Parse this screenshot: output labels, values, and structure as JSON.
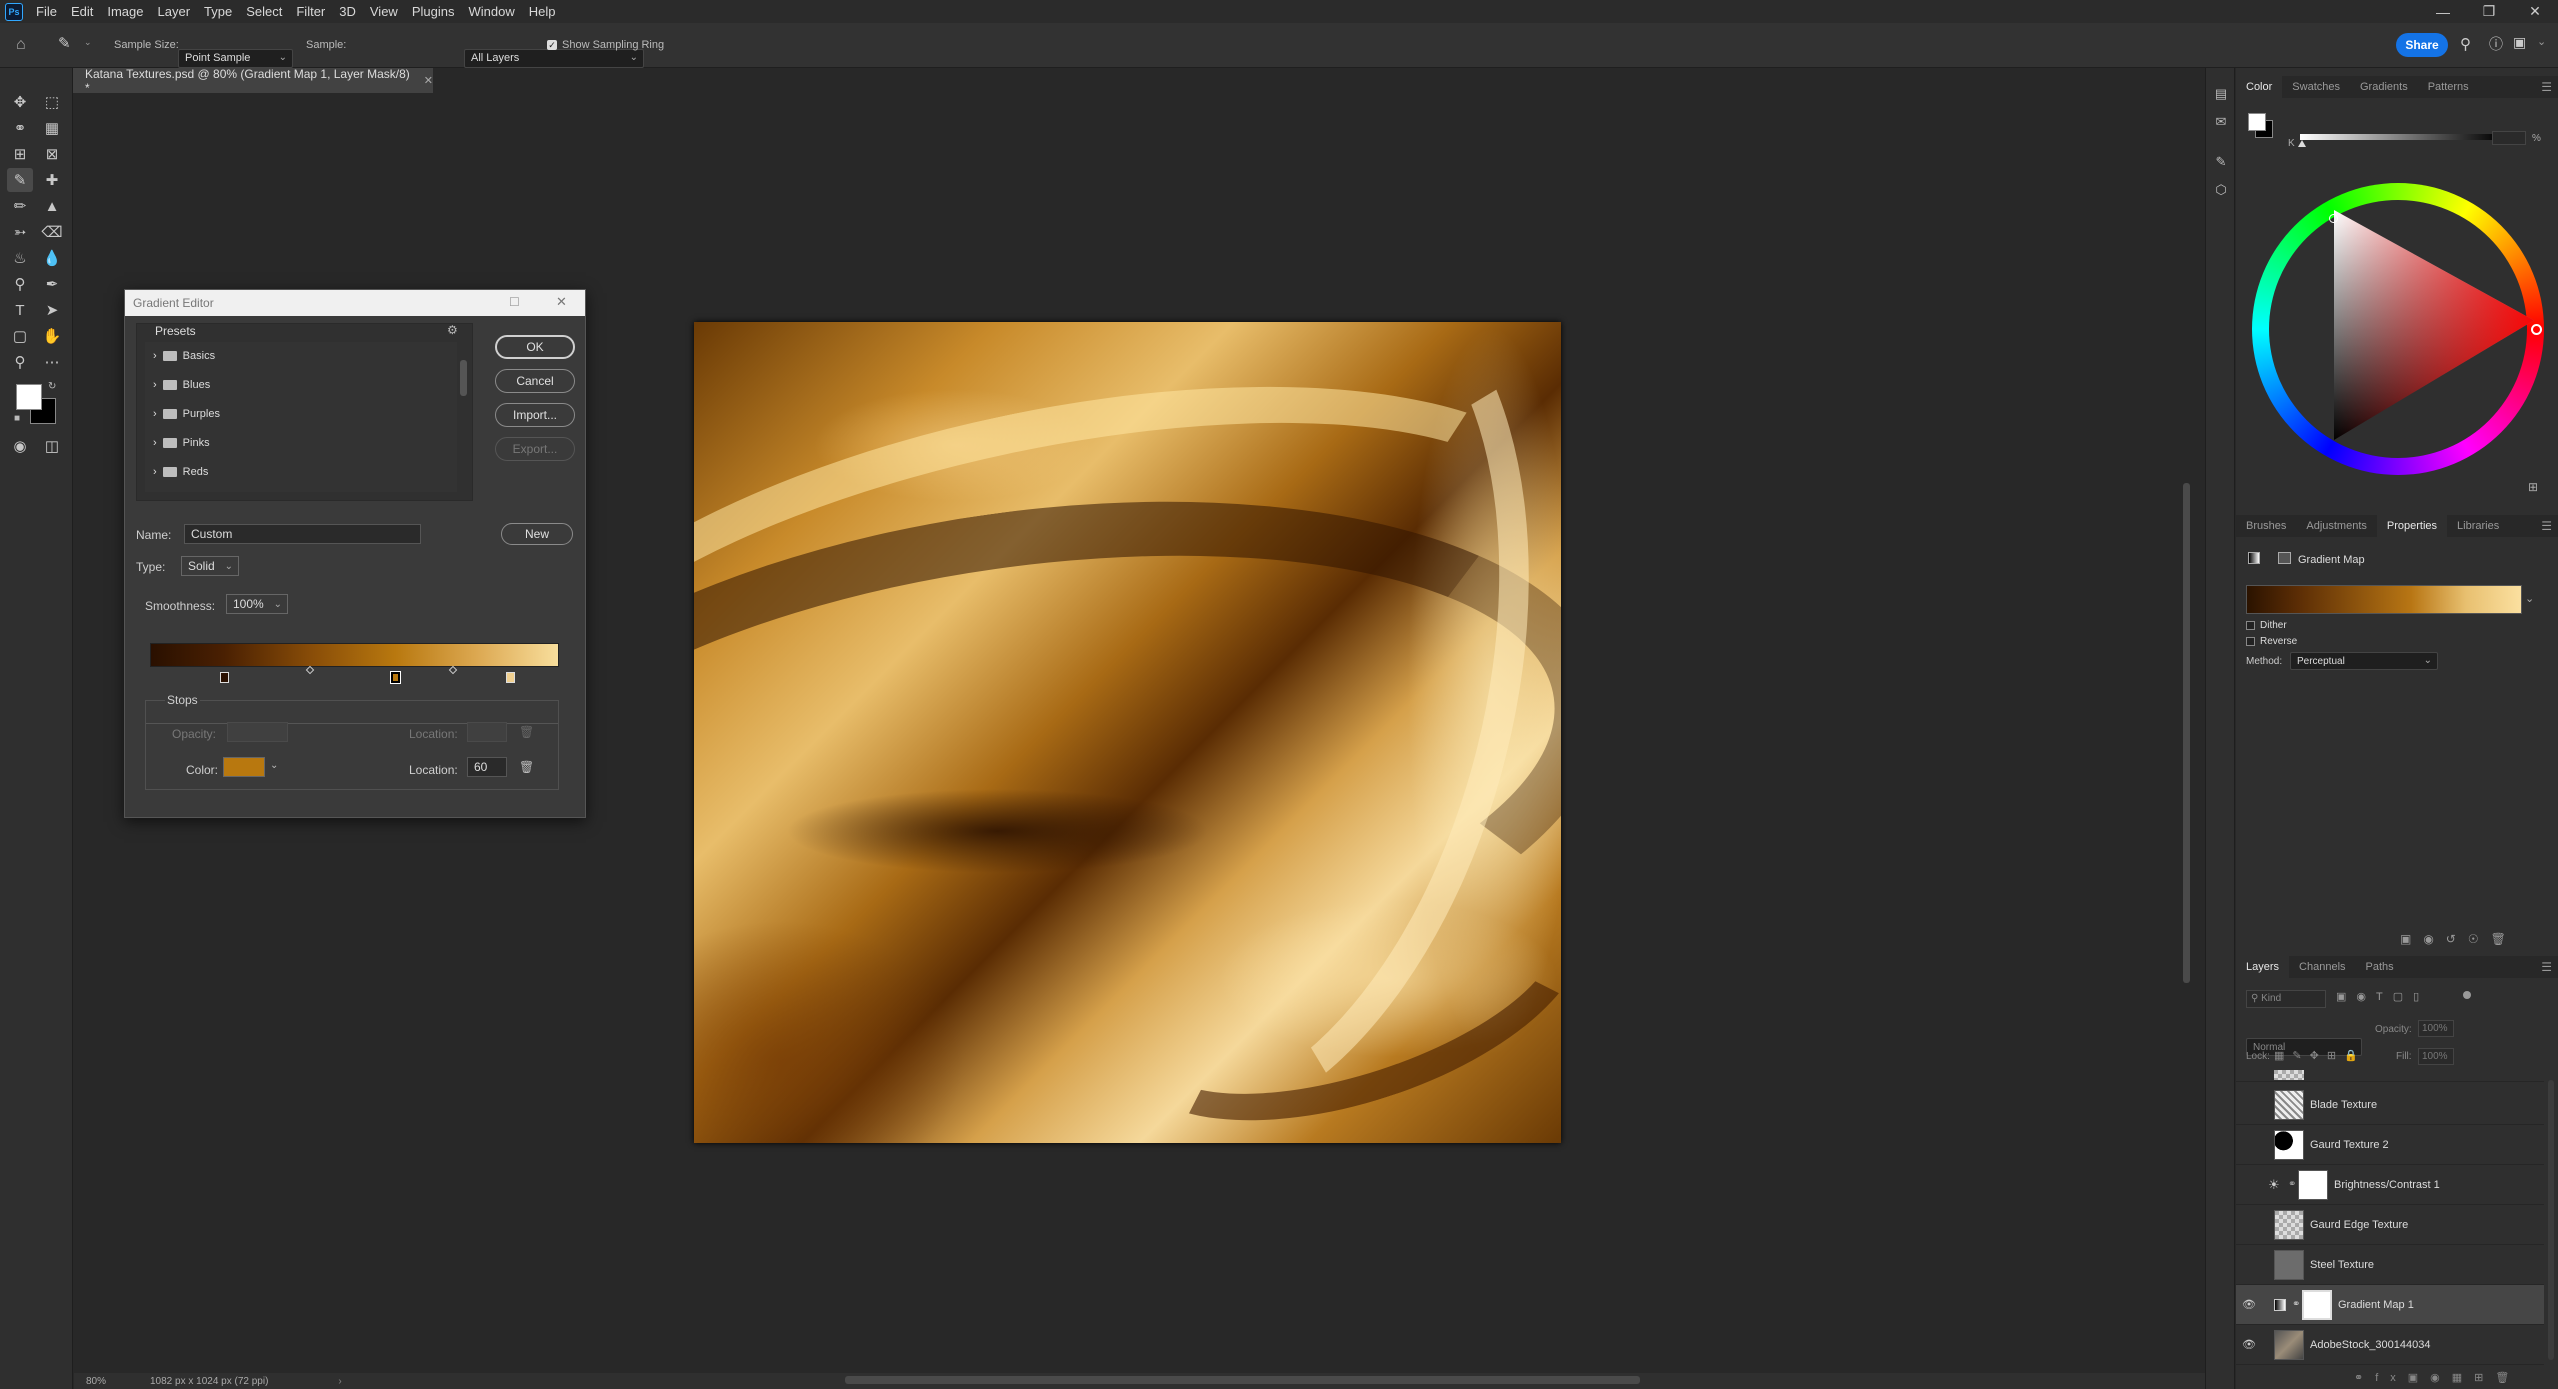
{
  "menubar": {
    "logo": "Ps",
    "items": [
      "File",
      "Edit",
      "Image",
      "Layer",
      "Type",
      "Select",
      "Filter",
      "3D",
      "View",
      "Plugins",
      "Window",
      "Help"
    ]
  },
  "options_bar": {
    "sample_size_label": "Sample Size:",
    "sample_size_value": "Point Sample",
    "sample_label": "Sample:",
    "sample_value": "All Layers",
    "show_ring_label": "Show Sampling Ring",
    "share_label": "Share"
  },
  "document_tab": {
    "title": "Katana Textures.psd @ 80% (Gradient Map 1, Layer Mask/8) *"
  },
  "status_bar": {
    "zoom": "80%",
    "doc_info": "1082 px x 1024 px (72 ppi)"
  },
  "color_panel": {
    "tabs": [
      "Color",
      "Swatches",
      "Gradients",
      "Patterns"
    ],
    "active_tab": "Color",
    "k_label": "K",
    "percent": "%"
  },
  "properties_panel": {
    "tabs": [
      "Brushes",
      "Adjustments",
      "Properties",
      "Libraries"
    ],
    "active_tab": "Properties",
    "title": "Gradient Map",
    "dither_label": "Dither",
    "reverse_label": "Reverse",
    "method_label": "Method:",
    "method_value": "Perceptual"
  },
  "layers_panel": {
    "tabs": [
      "Layers",
      "Channels",
      "Paths"
    ],
    "active_tab": "Layers",
    "kind_placeholder": "Kind",
    "blend_mode": "Normal",
    "opacity_label": "Opacity:",
    "opacity_value": "100%",
    "lock_label": "Lock:",
    "fill_label": "Fill:",
    "fill_value": "100%",
    "layers": [
      {
        "name": "Blade Texture",
        "visible": false,
        "selected": false
      },
      {
        "name": "Gaurd Texture 2",
        "visible": false,
        "selected": false
      },
      {
        "name": "Brightness/Contrast 1",
        "visible": false,
        "selected": false
      },
      {
        "name": "Gaurd Edge Texture",
        "visible": false,
        "selected": false
      },
      {
        "name": "Steel Texture",
        "visible": false,
        "selected": false
      },
      {
        "name": "Gradient Map 1",
        "visible": true,
        "selected": true
      },
      {
        "name": "AdobeStock_300144034",
        "visible": true,
        "selected": false
      }
    ]
  },
  "gradient_editor": {
    "title": "Gradient Editor",
    "presets_label": "Presets",
    "presets": [
      "Basics",
      "Blues",
      "Purples",
      "Pinks",
      "Reds"
    ],
    "ok_label": "OK",
    "cancel_label": "Cancel",
    "import_label": "Import...",
    "export_label": "Export...",
    "name_label": "Name:",
    "name_value": "Custom",
    "new_label": "New",
    "type_label": "Type:",
    "type_value": "Solid",
    "smoothness_label": "Smoothness:",
    "smoothness_value": "100%",
    "stops_label": "Stops",
    "opacity_label": "Opacity:",
    "location_label": "Location:",
    "color_label": "Color:",
    "color_location_value": "60",
    "selected_color": "#b8780f",
    "stop_positions_percent": [
      18,
      60,
      88
    ],
    "midpoint_positions_percent": [
      39,
      74
    ]
  }
}
